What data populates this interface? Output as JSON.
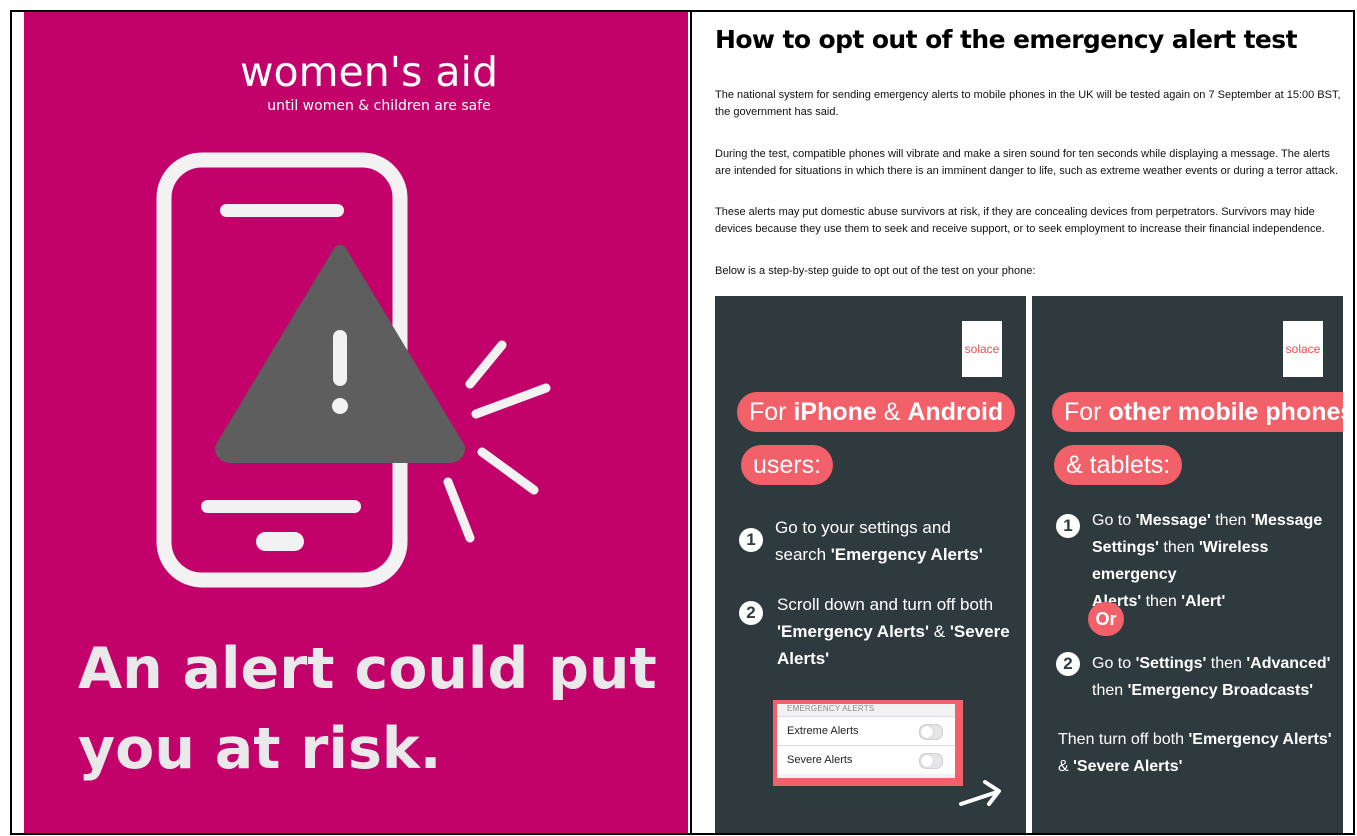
{
  "poster": {
    "brand": "women's aid",
    "tagline": "until women & children are safe",
    "headline_line1": "An alert could put",
    "headline_line2": "you at risk.",
    "bg_color": "#c2026a",
    "phone_icon": "phone-with-warning-icon"
  },
  "article": {
    "title": "How to opt out of the emergency alert test",
    "paragraphs": [
      "The national system for sending emergency alerts to mobile phones in the UK will be tested again on 7 September at 15:00 BST, the government has said.",
      "During the test, compatible phones will vibrate and make a siren sound for ten seconds while displaying a message. The alerts are intended for situations in which there is an imminent danger to life, such as extreme weather events or during a terror attack.",
      "These alerts may put domestic abuse survivors at risk, if they are concealing devices from perpetrators. Survivors may hide devices because they use them to seek and receive support, or to seek employment to increase their financial independence.",
      "Below is a step-by-step guide to opt out of the test on your phone:"
    ]
  },
  "guide": {
    "logo_text": "solace",
    "card_color": "#2f3a3f",
    "accent_color": "#f26169",
    "left": {
      "heading_part1": "For ",
      "heading_bold": "iPhone",
      "heading_part2": " & ",
      "heading_bold2": "Android",
      "heading_line2": "users:",
      "step1_num": "1",
      "step1_a": "Go to your settings and",
      "step1_b": "search ",
      "step1_bold": "'Emergency Alerts'",
      "step2_num": "2",
      "step2_a": "Scroll down and turn off both",
      "step2_bold1": "'Emergency Alerts'",
      "step2_amp": " & ",
      "step2_bold2": "'Severe",
      "step2_bold3": "Alerts'",
      "settings_header": "EMERGENCY ALERTS",
      "settings_row1": "Extreme Alerts",
      "settings_row2": "Severe Alerts"
    },
    "right": {
      "heading_part1": "For ",
      "heading_bold": "other mobile phones",
      "heading_line2": "& tablets:",
      "step1_num": "1",
      "step1_a": "Go to ",
      "step1_b1": "'Message'",
      "step1_c": " then ",
      "step1_b2": "'Message",
      "step1_b3": "Settings'",
      "step1_d": " then ",
      "step1_b4": "'Wireless emergency",
      "step1_b5": "Alerts'",
      "step1_e": " then ",
      "step1_b6": "'Alert'",
      "or_label": "Or",
      "step2_num": "2",
      "step2_a": "Go to ",
      "step2_b1": "'Settings'",
      "step2_c": " then ",
      "step2_b2": "'Advanced'",
      "step2_d": "then ",
      "step2_b3": "'Emergency Broadcasts'",
      "final_a": "Then turn off both ",
      "final_b1": "'Emergency Alerts'",
      "final_c": "& ",
      "final_b2": "'Severe Alerts'"
    }
  }
}
